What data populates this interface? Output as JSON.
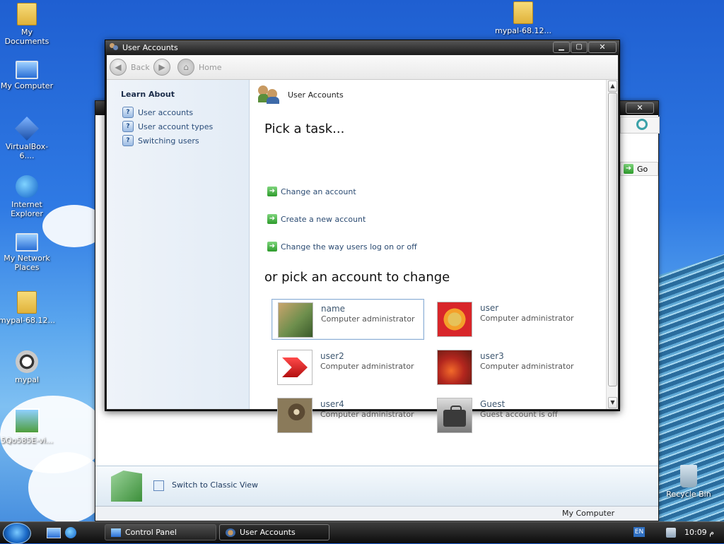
{
  "desktop": {
    "icons": [
      {
        "label": "My Documents",
        "icon": "folder-icon"
      },
      {
        "label": "My Computer",
        "icon": "computer-icon"
      },
      {
        "label": "VirtualBox-6....",
        "icon": "virtualbox-icon"
      },
      {
        "label": "Internet Explorer",
        "icon": "ie-icon"
      },
      {
        "label": "My Network Places",
        "icon": "network-icon"
      },
      {
        "label": "mypal-68.12...",
        "icon": "folder-icon"
      },
      {
        "label": "mypal",
        "icon": "mypal-icon"
      },
      {
        "label": "5Qo585E-vi...",
        "icon": "image-icon"
      },
      {
        "label": "mypal-68.12...",
        "icon": "folder-icon"
      },
      {
        "label": "Recycle Bin",
        "icon": "recycle-bin-icon"
      }
    ]
  },
  "background_window": {
    "go_label": "Go",
    "bottom_link": "Switch to Classic View",
    "status_text": "My Computer"
  },
  "window": {
    "title": "User Accounts",
    "nav": {
      "back": "Back",
      "home": "Home"
    },
    "sidebar": {
      "heading": "Learn About",
      "links": [
        "User accounts",
        "User account types",
        "Switching users"
      ]
    },
    "header": "User Accounts",
    "pick_task": "Pick a task...",
    "tasks": [
      "Change an account",
      "Create a new account",
      "Change the way users log on or off"
    ],
    "pick_account": "or pick an account to change",
    "accounts": [
      {
        "name": "name",
        "role": "Computer administrator"
      },
      {
        "name": "user",
        "role": "Computer administrator"
      },
      {
        "name": "user2",
        "role": "Computer administrator"
      },
      {
        "name": "user3",
        "role": "Computer administrator"
      },
      {
        "name": "user4",
        "role": "Computer administrator"
      },
      {
        "name": "Guest",
        "role": "Guest account is off"
      }
    ]
  },
  "taskbar": {
    "items": [
      "Control Panel",
      "User Accounts"
    ],
    "language": "EN",
    "clock": "10:09 م"
  }
}
